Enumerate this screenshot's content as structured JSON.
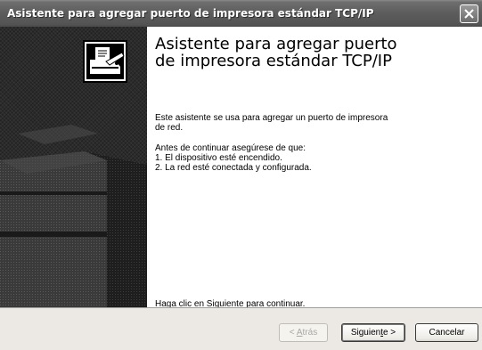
{
  "window": {
    "title": "Asistente para agregar puerto de impresora estándar TCP/IP"
  },
  "main": {
    "heading_line1": "Asistente para agregar puerto",
    "heading_line2": "de impresora estándar TCP/IP",
    "intro_line1": "Este asistente se usa para agregar un puerto de impresora",
    "intro_line2": "de red.",
    "check_intro": "Antes de continuar asegúrese de que:",
    "checklist": [
      "1.  El dispositivo esté encendido.",
      "2.  La red esté conectada y configurada."
    ],
    "continue_text": "Haga clic en Siguiente para continuar."
  },
  "buttons": {
    "back_prefix": "< ",
    "back_hotkey": "A",
    "back_rest": "trás",
    "next_prefix": "Siguien",
    "next_hotkey": "t",
    "next_rest": "e >",
    "cancel_label": "Cancelar"
  },
  "icons": {
    "close": "close-icon",
    "wizard": "printer-wizard-icon"
  },
  "colors": {
    "titlebar": "#5c5c5c",
    "side_panel": "#2b2b2b",
    "footer": "#ece9e4"
  }
}
